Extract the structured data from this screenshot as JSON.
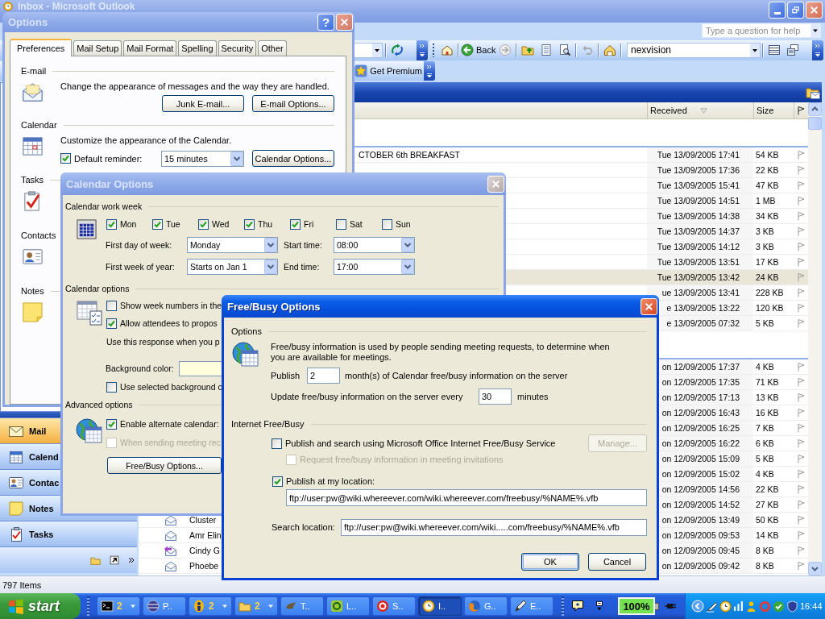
{
  "outlook": {
    "title": "Inbox - Microsoft Outlook",
    "help_box": {
      "placeholder": "Type a question for help"
    },
    "toolbar": {
      "back_button": "Back",
      "search_combo": "nexvision",
      "premium_button": "Get Premium"
    },
    "columns": [
      {
        "label": "Received",
        "sorted": true
      },
      {
        "label": "Size",
        "sorted": false
      }
    ],
    "groups": [
      {
        "rows": [
          {
            "subject": "CTOBER 6th BREAKFAST",
            "received": "Tue 13/09/2005 17:41",
            "size": "54 KB",
            "selected": false
          },
          {
            "received": "Tue 13/09/2005 17:36",
            "size": "22 KB",
            "selected": false
          },
          {
            "received": "Tue 13/09/2005 15:41",
            "size": "47 KB",
            "selected": false
          },
          {
            "received": "Tue 13/09/2005 14:51",
            "size": "1 MB",
            "selected": false
          },
          {
            "received": "Tue 13/09/2005 14:38",
            "size": "34 KB",
            "selected": false
          },
          {
            "received": "Tue 13/09/2005 14:37",
            "size": "3 KB",
            "selected": false
          },
          {
            "received": "Tue 13/09/2005 14:12",
            "size": "3 KB",
            "selected": false
          },
          {
            "received": "Tue 13/09/2005 13:51",
            "size": "17 KB",
            "selected": false
          },
          {
            "received": "Tue 13/09/2005 13:42",
            "size": "24 KB",
            "selected": true
          },
          {
            "received": "ue 13/09/2005 13:41",
            "size": "228 KB",
            "selected": false
          },
          {
            "received": "e 13/09/2005 13:22",
            "size": "120 KB",
            "selected": false
          },
          {
            "received": "e 13/09/2005 07:32",
            "size": "5 KB",
            "selected": false
          }
        ]
      },
      {
        "rows": [
          {
            "received": "on 12/09/2005 17:37",
            "size": "4 KB",
            "selected": false
          },
          {
            "received": "on 12/09/2005 17:35",
            "size": "71 KB",
            "selected": false
          },
          {
            "received": "on 12/09/2005 17:13",
            "size": "13 KB",
            "selected": false
          },
          {
            "received": "on 12/09/2005 16:43",
            "size": "16 KB",
            "selected": false
          },
          {
            "received": "on 12/09/2005 16:25",
            "size": "7 KB",
            "selected": false
          },
          {
            "received": "on 12/09/2005 16:22",
            "size": "6 KB",
            "selected": false
          },
          {
            "received": "on 12/09/2005 15:09",
            "size": "5 KB",
            "selected": false
          },
          {
            "received": "on 12/09/2005 15:02",
            "size": "4 KB",
            "selected": false
          },
          {
            "received": "on 12/09/2005 14:56",
            "size": "22 KB",
            "selected": false
          },
          {
            "received": "on 12/09/2005 14:52",
            "size": "27 KB",
            "selected": false
          },
          {
            "from": "Cluster",
            "replied": false,
            "received": "on 12/09/2005 13:49",
            "size": "50 KB",
            "selected": false
          },
          {
            "from": "Amr Elin",
            "replied": false,
            "received": "on 12/09/2005 09:53",
            "size": "14 KB",
            "selected": false
          },
          {
            "from": "Cindy G",
            "replied": true,
            "received": "on 12/09/2005 09:45",
            "size": "8 KB",
            "selected": false
          },
          {
            "from": "Phoebe",
            "replied": false,
            "received": "on 12/09/2005 09:42",
            "size": "8 KB",
            "selected": false
          }
        ]
      }
    ],
    "nav_buttons": [
      {
        "label": "Mail",
        "kind": "mail",
        "selected": true
      },
      {
        "label": "Calend",
        "kind": "calendar",
        "selected": false
      },
      {
        "label": "Contac",
        "kind": "contacts",
        "selected": false
      },
      {
        "label": "Notes",
        "kind": "notes",
        "selected": false
      },
      {
        "label": "Tasks",
        "kind": "tasks",
        "selected": false
      }
    ],
    "status_bar": "797 Items"
  },
  "options_dialog": {
    "title": "Options",
    "help_button": "?",
    "tabs": [
      {
        "label": "Preferences",
        "selected": true
      },
      {
        "label": "Mail Setup",
        "selected": false
      },
      {
        "label": "Mail Format",
        "selected": false
      },
      {
        "label": "Spelling",
        "selected": false
      },
      {
        "label": "Security",
        "selected": false
      },
      {
        "label": "Other",
        "selected": false
      }
    ],
    "sections": [
      {
        "kind": "email",
        "heading": "E-mail",
        "description": "Change the appearance of messages and the way they are handled.",
        "buttons": [
          "Junk E-mail...",
          "E-mail Options..."
        ]
      },
      {
        "kind": "calendar",
        "heading": "Calendar",
        "description": "Customize the appearance of the Calendar.",
        "reminder": {
          "label": "Default reminder:",
          "checked": true,
          "value": "15 minutes"
        },
        "buttons": [
          "Calendar Options..."
        ]
      },
      {
        "kind": "tasks",
        "heading": "Tasks"
      },
      {
        "kind": "contacts",
        "heading": "Contacts"
      },
      {
        "kind": "notes",
        "heading": "Notes"
      }
    ]
  },
  "calendar_options": {
    "title": "Calendar Options",
    "work_week": {
      "heading": "Calendar work week",
      "days": [
        {
          "label": "Mon",
          "checked": true
        },
        {
          "label": "Tue",
          "checked": true
        },
        {
          "label": "Wed",
          "checked": true
        },
        {
          "label": "Thu",
          "checked": true
        },
        {
          "label": "Fri",
          "checked": true
        },
        {
          "label": "Sat",
          "checked": false
        },
        {
          "label": "Sun",
          "checked": false
        }
      ],
      "fields": [
        {
          "label": "First day of week:",
          "value": "Monday"
        },
        {
          "label": "Start time:",
          "value": "08:00"
        },
        {
          "label": "First week of year:",
          "value": "Starts on Jan 1"
        },
        {
          "label": "End time:",
          "value": "17:00"
        }
      ]
    },
    "options": {
      "heading": "Calendar options",
      "week_numbers": {
        "label": "Show week numbers in the",
        "checked": false,
        "disabled": false
      },
      "allow_propose": {
        "label": "Allow attendees to propos",
        "checked": true,
        "disabled": false
      },
      "response_text": "Use this response when you p",
      "background_label": "Background color:",
      "use_background": {
        "label": "Use selected background c",
        "checked": false,
        "disabled": false
      }
    },
    "advanced": {
      "heading": "Advanced options",
      "alternate_calendar": {
        "label": "Enable alternate calendar:",
        "checked": true,
        "disabled": false
      },
      "meeting_requests": {
        "label": "When sending meeting rec",
        "checked": false,
        "disabled": true
      },
      "free_busy_button": "Free/Busy Options..."
    }
  },
  "free_busy": {
    "title": "Free/Busy Options",
    "options_heading": "Options",
    "description": "Free/busy information is used by people sending meeting requests, to determine when you are available for meetings.",
    "publish": {
      "label": "Publish",
      "value": "2",
      "suffix": "month(s) of Calendar free/busy information on the server"
    },
    "update": {
      "label": "Update free/busy information on the server every",
      "value": "30",
      "suffix": "minutes"
    },
    "internet_heading": "Internet Free/Busy",
    "office_service": {
      "label": "Publish and search using Microsoft Office Internet Free/Busy Service",
      "checked": false,
      "disabled": false
    },
    "manage_button": {
      "label": "Manage...",
      "disabled": true
    },
    "request_info": {
      "label": "Request free/busy information in meeting invitations",
      "checked": false,
      "disabled": true
    },
    "publish_location": {
      "label": "Publish at my location:",
      "checked": true,
      "disabled": false,
      "value": "ftp://user:pw@wiki.whereever.com/wiki.whereever.com/freebusy/%NAME%.vfb"
    },
    "search_location": {
      "label": "Search location:",
      "value": "ftp://user:pw@wiki.whereever.com/wiki.....com/freebusy/%NAME%.vfb"
    },
    "buttons": [
      {
        "label": "OK",
        "default": true
      },
      {
        "label": "Cancel",
        "default": false
      }
    ]
  },
  "taskbar": {
    "start_button": "start",
    "tasks": [
      {
        "kind": "console",
        "label": "2",
        "grouped": true,
        "selected": false
      },
      {
        "kind": "sphere",
        "label": "P..",
        "grouped": false,
        "selected": false
      },
      {
        "kind": "figure",
        "label": "2",
        "grouped": true,
        "selected": false
      },
      {
        "kind": "folder",
        "label": "2",
        "grouped": true,
        "selected": false
      },
      {
        "kind": "bird",
        "label": "T..",
        "grouped": false,
        "selected": false
      },
      {
        "kind": "ring",
        "label": "L..",
        "grouped": false,
        "selected": false
      },
      {
        "kind": "disc",
        "label": "S..",
        "grouped": false,
        "selected": false
      },
      {
        "kind": "clock",
        "label": "I..",
        "grouped": false,
        "selected": true
      },
      {
        "kind": "globe",
        "label": "G..",
        "grouped": false,
        "selected": false
      },
      {
        "kind": "pen",
        "label": "E..",
        "grouped": false,
        "selected": false
      }
    ],
    "indicator": "100%",
    "clock": "16:44"
  }
}
